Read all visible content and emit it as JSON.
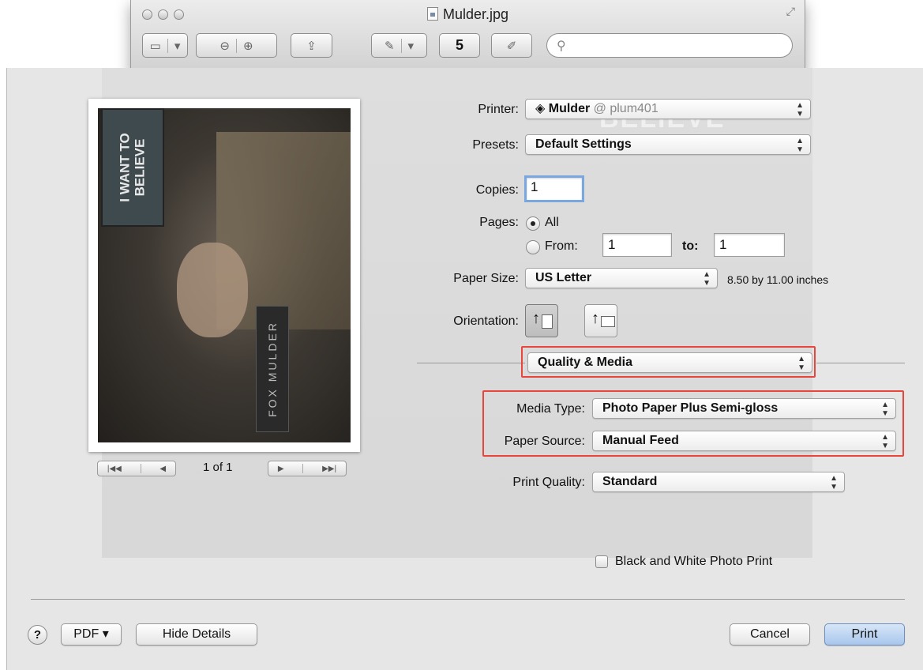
{
  "window": {
    "title": "Mulder.jpg",
    "search_placeholder": "",
    "rotate_label": "5"
  },
  "preview": {
    "poster_text_line1": "I WANT TO",
    "poster_text_line2": "BELIEVE",
    "nameplate_text": "FOX MULDER",
    "watermark_text": "BELIEVE",
    "page_counter": "1 of 1"
  },
  "form": {
    "printer_label": "Printer:",
    "printer_name": "Mulder",
    "printer_host": "@ plum401",
    "presets_label": "Presets:",
    "presets_value": "Default Settings",
    "copies_label": "Copies:",
    "copies_value": "1",
    "pages_label": "Pages:",
    "pages_all": "All",
    "pages_from": "From:",
    "pages_from_value": "1",
    "pages_to": "to:",
    "pages_to_value": "1",
    "paper_size_label": "Paper Size:",
    "paper_size_value": "US Letter",
    "paper_size_dims": "8.50 by 11.00 inches",
    "orientation_label": "Orientation:",
    "section_value": "Quality & Media",
    "media_type_label": "Media Type:",
    "media_type_value": "Photo Paper Plus Semi-gloss",
    "paper_source_label": "Paper Source:",
    "paper_source_value": "Manual Feed",
    "print_quality_label": "Print Quality:",
    "print_quality_value": "Standard",
    "bw_label": "Black and White Photo Print"
  },
  "footer": {
    "help": "?",
    "pdf": "PDF ▾",
    "hide_details": "Hide Details",
    "cancel": "Cancel",
    "print": "Print"
  },
  "colors": {
    "highlight": "#e8453c",
    "default_button": "#a8c6ec"
  }
}
